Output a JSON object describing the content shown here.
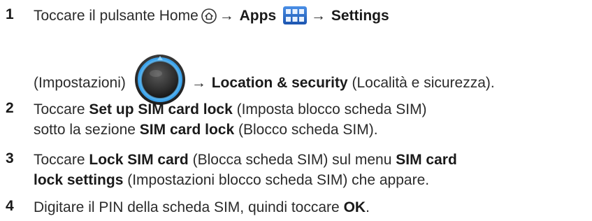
{
  "steps": [
    {
      "number": "1",
      "line1": {
        "t1": "Toccare il pulsante Home",
        "arrow1": "→",
        "b1": "Apps",
        "arrow2": "→",
        "b2": "Settings"
      },
      "line2": {
        "t1": "(Impostazioni)",
        "arrow": "→",
        "b1": "Location & security",
        "t2": "(Località e sicurezza)."
      },
      "icons": [
        "home-button-icon",
        "apps-grid-icon",
        "settings-dial-icon"
      ]
    },
    {
      "number": "2",
      "line1": {
        "t1": "Toccare",
        "b1": "Set up SIM card lock",
        "t2": "(Imposta blocco scheda SIM)"
      },
      "line2": {
        "t1": "sotto la sezione",
        "b1": "SIM card lock",
        "t2": "(Blocco scheda SIM)."
      }
    },
    {
      "number": "3",
      "line1": {
        "t1": "Toccare",
        "b1": "Lock SIM card",
        "t2": "(Blocca scheda SIM) sul menu",
        "b2": "SIM card"
      },
      "line2": {
        "b1": "lock settings",
        "t1": "(Impostazioni blocco scheda SIM) che appare."
      }
    },
    {
      "number": "4",
      "line1": {
        "t1": "Digitare il PIN della scheda SIM, quindi toccare",
        "b1": "OK",
        "t2": "."
      }
    }
  ],
  "colors": {
    "text": "#2b2b2b",
    "apps_icon_blue": "#2a6fd0",
    "settings_ring_blue": "#3aa0e8"
  }
}
